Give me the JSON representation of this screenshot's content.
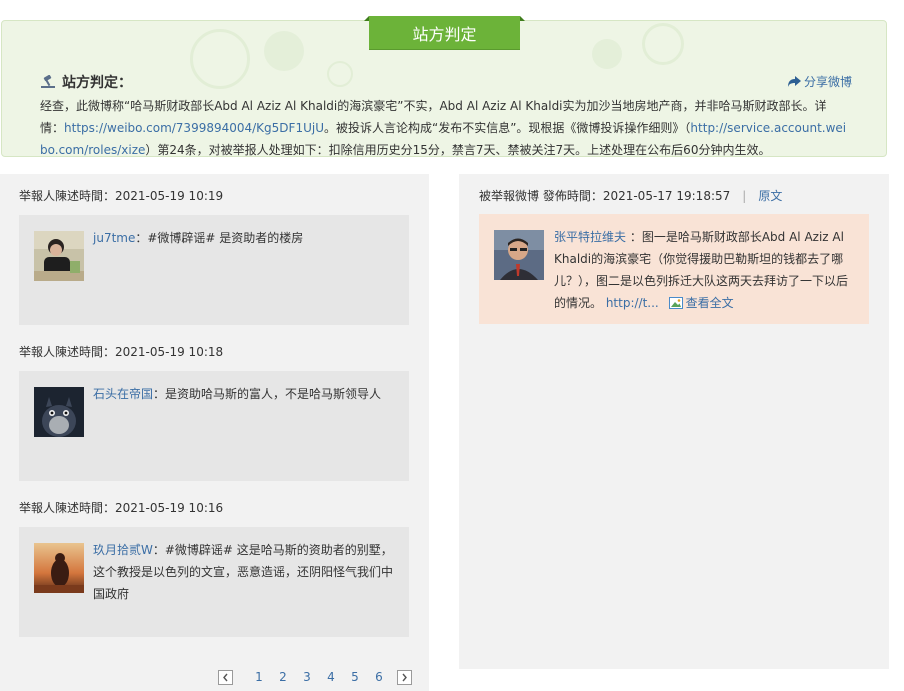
{
  "verdict": {
    "ribbon_title": "站方判定",
    "heading": "站方判定：",
    "share_label": "分享微博",
    "body_pre": "经查，此微博称“哈马斯财政部长Abd Al Aziz Al Khaldi的海滨豪宅”不实，Abd Al Aziz Al Khaldi实为加沙当地房地产商，并非哈马斯财政部长。详情：",
    "body_link1": "https://weibo.com/7399894004/Kg5DF1UjU",
    "body_mid": "。被投诉人言论构成“发布不实信息”。现根据《微博投诉操作细则》（",
    "body_link2": "http://service.account.weibo.com/roles/xize",
    "body_post": "）第24条，对被举报人处理如下：扣除信用历史分15分，禁言7天、禁被关注7天。上述处理在公布后60分钟内生效。"
  },
  "reports": [
    {
      "meta": "举報人陳述時間：2021-05-19 10:19",
      "user": "ju7tme",
      "text": "：#微博辟谣# 是资助者的楼房"
    },
    {
      "meta": "举報人陳述時間：2021-05-19 10:18",
      "user": "石头在帝国",
      "text": "：是资助哈马斯的富人，不是哈马斯领导人"
    },
    {
      "meta": "举報人陳述時間：2021-05-19 10:16",
      "user": "玖月拾贰W",
      "text": "：#微博辟谣# 这是哈马斯的资助者的别墅，这个教授是以色列的文宣，恶意造谣，还阴阳怪气我们中国政府"
    }
  ],
  "original": {
    "meta": "被举報微博 發佈時間：2021-05-17 19:18:57",
    "separator": "|",
    "original_link": "原文",
    "user": "张平特拉维夫",
    "text": " ：图一是哈马斯财政部长Abd Al Aziz Al Khaldi的海滨豪宅（你觉得援助巴勒斯坦的钱都去了哪儿？），图二是以色列拆迁大队这两天去拜访了一下以后的情况。 ",
    "short_link": "http://t...",
    "view_full": "查看全文"
  },
  "pagination": {
    "pages": [
      "1",
      "2",
      "3",
      "4",
      "5",
      "6"
    ],
    "prev_icon": "chevron-left-icon",
    "next_icon": "chevron-right-icon"
  },
  "colors": {
    "accent_green": "#6cb339",
    "link_blue": "#3b6ea5",
    "verdict_bg": "#eef5e5",
    "original_card_bg": "#f9e3d6"
  }
}
